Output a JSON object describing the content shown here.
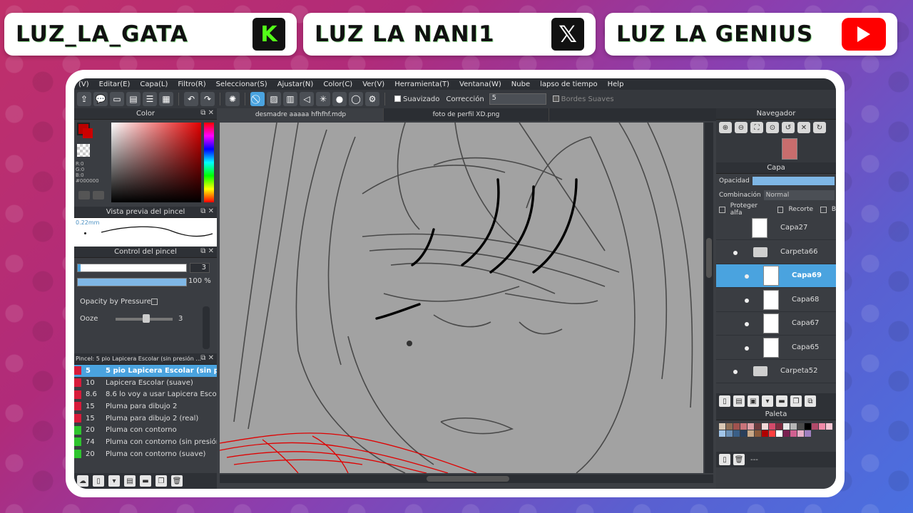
{
  "banners": [
    {
      "name": "LUZ_LA_GATA",
      "icon": "kick-icon",
      "icon_text": "K"
    },
    {
      "name": "LUZ LA NANI1",
      "icon": "x-icon",
      "icon_text": "𝕏"
    },
    {
      "name": "LUZ LA GENIUS",
      "icon": "youtube-icon",
      "icon_text": ""
    }
  ],
  "menu": [
    "(V)",
    "Editar(E)",
    "Capa(L)",
    "Filtro(R)",
    "Seleccionar(S)",
    "Ajustar(N)",
    "Color(C)",
    "Ver(V)",
    "Herramienta(T)",
    "Ventana(W)",
    "Nube",
    "lapso de tiempo",
    "Help"
  ],
  "toolbar": {
    "suavizado": "Suavizado",
    "correccion_label": "Corrección",
    "correccion_value": "5",
    "bordes": "Bordes Suaves"
  },
  "color_panel": {
    "title": "Color",
    "rgb_text": "R:0\nG:0\nB:0\n#000000",
    "accent": "#e30000"
  },
  "brush_preview": {
    "title": "Vista previa del pincel",
    "size": "0.22mm"
  },
  "brush_control": {
    "title": "Control del pincel",
    "size_value": "3",
    "opacity_value": "100 %",
    "opacity_pressure": "Opacity by Pressure",
    "ooze_label": "Ooze",
    "ooze_value": "3"
  },
  "brushes": {
    "title": "Pincel: 5 pio Lapicera Escolar (sin presión ...",
    "items": [
      {
        "color": "#d81b3a",
        "value": "5",
        "name": "5 pio Lapicera Escolar (sin presión)",
        "selected": true
      },
      {
        "color": "#d81b3a",
        "value": "10",
        "name": "Lapicera Escolar (suave)"
      },
      {
        "color": "#d81b3a",
        "value": "8.6",
        "name": "8.6 lo voy a usar Lapicera Escolar"
      },
      {
        "color": "#d81b3a",
        "value": "15",
        "name": "Pluma para dibujo 2"
      },
      {
        "color": "#d81b3a",
        "value": "15",
        "name": "Pluma para dibujo 2 (real)"
      },
      {
        "color": "#2ec52e",
        "value": "20",
        "name": "Pluma con contorno"
      },
      {
        "color": "#2ec52e",
        "value": "74",
        "name": "Pluma con contorno (sin presión)"
      },
      {
        "color": "#2ec52e",
        "value": "20",
        "name": "Pluma con contorno (suave)"
      }
    ]
  },
  "tabs": [
    "desmadre aaaaa hfhfhf.mdp",
    "foto de perfil XD.png"
  ],
  "right": {
    "navigator_title": "Navegador",
    "layer_title": "Capa",
    "opacity_label": "Opacidad",
    "blend_label": "Combinación",
    "blend_value": "Normal",
    "protect_alpha": "Proteger alfa",
    "clipping": "Recorte",
    "extra": "B",
    "palette_title": "Paleta",
    "palette_more": "---"
  },
  "layers": [
    {
      "name": "Capa27",
      "type": "layer"
    },
    {
      "name": "Carpeta66",
      "type": "folder"
    },
    {
      "name": "Capa69",
      "type": "layer",
      "selected": true
    },
    {
      "name": "Capa68",
      "type": "layer"
    },
    {
      "name": "Capa67",
      "type": "layer"
    },
    {
      "name": "Capa65",
      "type": "layer"
    },
    {
      "name": "Carpeta52",
      "type": "folder"
    }
  ],
  "palette_colors": [
    "#d9c8b4",
    "#8f6f56",
    "#a0524e",
    "#c9747a",
    "#e0a1a8",
    "#6d3b3e",
    "#f2d8d8",
    "#d34a6a",
    "#7e2c3f",
    "#e8e8e8",
    "#b6b6b6",
    "#4a4a4a",
    "#000000",
    "#b14a6a",
    "#f28aa8",
    "#f7c5d2",
    "#a0c4e8",
    "#6a8fb5",
    "#3a5f87",
    "#2a3f5a",
    "#c8a888",
    "#8a5a3a",
    "#b00000",
    "#ff4040",
    "#ffffff",
    "#7a2050",
    "#d06090",
    "#e8b0c8",
    "#a080c0"
  ]
}
